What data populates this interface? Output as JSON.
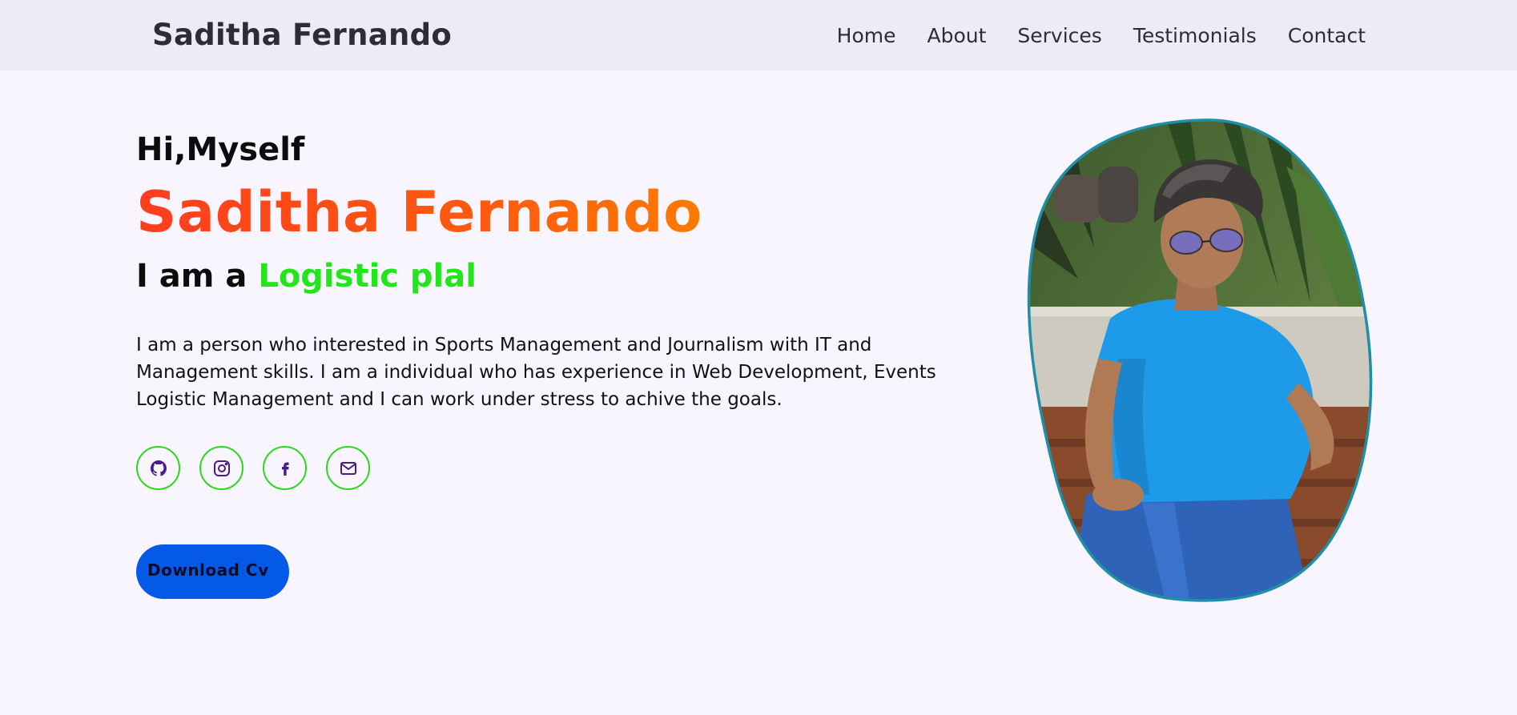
{
  "header": {
    "brand": "Saditha Fernando",
    "nav": [
      "Home",
      "About",
      "Services",
      "Testimonials",
      "Contact"
    ]
  },
  "hero": {
    "greeting": "Hi,Myself",
    "name": "Saditha Fernando",
    "role_prefix": "I am a ",
    "role_typed": "Logistic plal",
    "bio": "I am a person who interested in Sports Management and Journalism with IT and Management skills. I am a individual who has experience in Web Development, Events Logistic Management and I can work under stress to achive the goals.",
    "socials": [
      {
        "icon": "github-icon"
      },
      {
        "icon": "instagram-icon"
      },
      {
        "icon": "facebook-icon"
      },
      {
        "icon": "mail-icon"
      }
    ],
    "cv_label": "Download Cv"
  },
  "colors": {
    "header_bg": "#eeebf7",
    "page_bg": "#f9f5fe",
    "name_gradient_start": "#ff3d1f",
    "name_gradient_end": "#ff7a00",
    "role_accent": "#22e51b",
    "social_border": "#2bd91c",
    "social_icon": "#4b1a8a",
    "cv_button": "#045ae6",
    "portrait_border": "#1f8fa8"
  }
}
